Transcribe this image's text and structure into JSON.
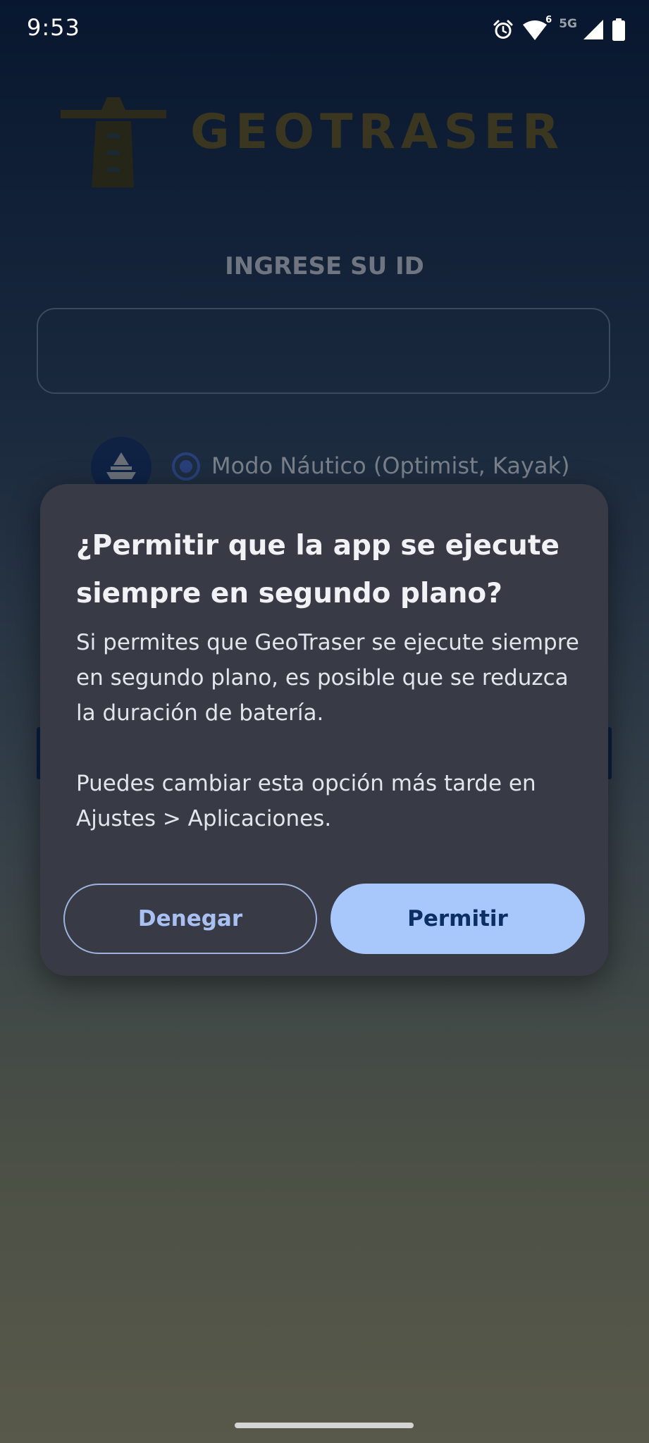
{
  "status_bar": {
    "time": "9:53",
    "network_label": "5G",
    "wifi_badge": "6",
    "icons": [
      "alarm-icon",
      "wifi-icon",
      "cellular-signal-icon",
      "battery-icon"
    ]
  },
  "app": {
    "logo_text": "GEOTRASER",
    "logo_tagline": "",
    "id_label": "INGRESE SU ID",
    "id_input_value": "",
    "mode_option_label": "Modo Náutico (Optimist, Kayak)"
  },
  "dialog": {
    "title": "¿Permitir que la app se ejecute siempre en segundo plano?",
    "body_paragraph_1": "Si permites que GeoTraser se ejecute siempre en segundo plano, es posible que se reduzca la duración de batería.",
    "body_paragraph_2": "Puedes cambiar esta opción más tarde en Ajustes > Aplicaciones.",
    "deny_label": "Denegar",
    "allow_label": "Permitir"
  },
  "colors": {
    "dialog_bg": "#383b46",
    "allow_button_bg": "#a8c7fa",
    "allow_button_text": "#0b2e63",
    "deny_button_text": "#a9c0f2"
  }
}
